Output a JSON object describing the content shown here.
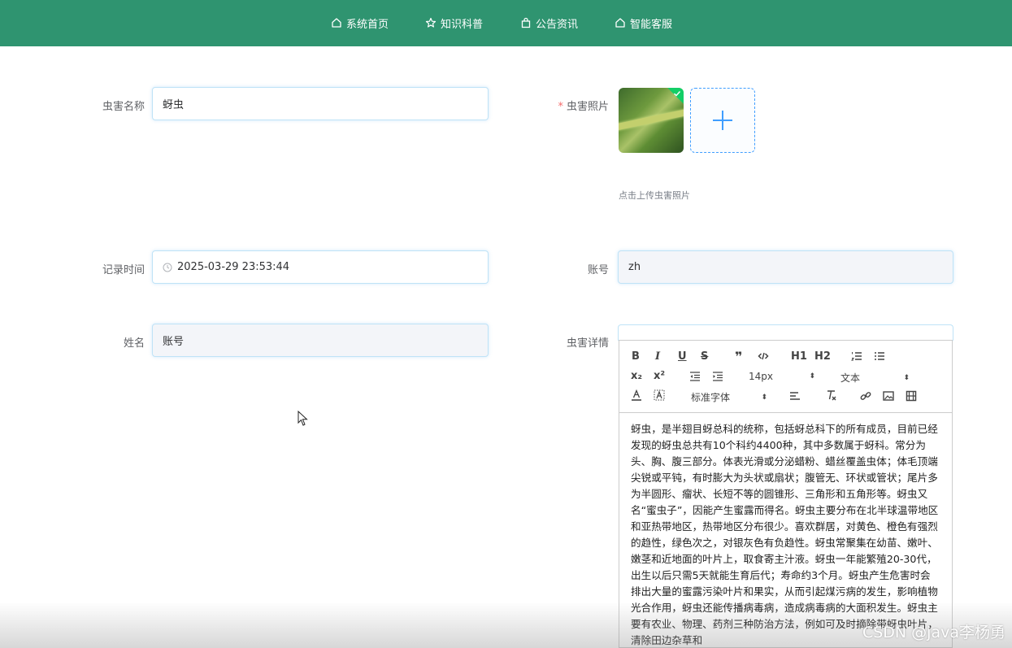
{
  "nav": {
    "items": [
      {
        "label": "系统首页",
        "icon": "home-icon"
      },
      {
        "label": "知识科普",
        "icon": "star-icon"
      },
      {
        "label": "公告资讯",
        "icon": "bag-icon"
      },
      {
        "label": "智能客服",
        "icon": "home-icon"
      }
    ]
  },
  "form": {
    "pest_name": {
      "label": "虫害名称",
      "value": "蚜虫"
    },
    "pest_photo": {
      "required_mark": "*",
      "label": "虫害照片",
      "tip": "点击上传虫害照片"
    },
    "record_time": {
      "label": "记录时间",
      "value": "2025-03-29 23:53:44"
    },
    "account": {
      "label": "账号",
      "value": "zh"
    },
    "name": {
      "label": "姓名",
      "value": "账号"
    },
    "detail": {
      "label": "虫害详情"
    }
  },
  "editor": {
    "font_size": "14px",
    "block_type": "文本",
    "font_family": "标准字体",
    "toolbar": {
      "h1": "H1",
      "h2": "H2",
      "subscript": "x₂",
      "superscript": "x²",
      "quote": "❞"
    },
    "content": "蚜虫，是半翅目蚜总科的统称，包括蚜总科下的所有成员，目前已经发现的蚜虫总共有10个科约4400种，其中多数属于蚜科。常分为头、胸、腹三部分。体表光滑或分泌蜡粉、蜡丝覆盖虫体；体毛顶端尖锐或平钝，有时膨大为头状或扇状；腹管无、环状或管状；尾片多为半圆形、瘤状、长短不等的圆锥形、三角形和五角形等。蚜虫又名“蜜虫子”，因能产生蜜露而得名。蚜虫主要分布在北半球温带地区和亚热带地区，热带地区分布很少。喜欢群居，对黄色、橙色有强烈的趋性，绿色次之，对银灰色有负趋性。蚜虫常聚集在幼苗、嫩叶、嫩茎和近地面的叶片上，取食寄主汁液。蚜虫一年能繁殖20-30代，出生以后只需5天就能生育后代；寿命约3个月。蚜虫产生危害时会排出大量的蜜露污染叶片和果实，从而引起煤污病的发生，影响植物光合作用，蚜虫还能传播病毒病，造成病毒病的大面积发生。蚜虫主要有农业、物理、药剂三种防治方法，例如可及时摘除带蚜虫叶片，清除田边杂草和"
  },
  "watermark": "CSDN @java李杨勇",
  "colors": {
    "nav_bg": "#2f9470",
    "required": "#f56c6c",
    "upload_border": "#409eff",
    "success": "#13ce66"
  }
}
